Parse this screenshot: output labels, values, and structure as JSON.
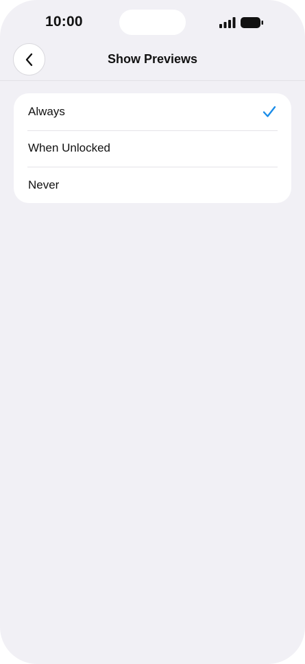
{
  "status_bar": {
    "time": "10:00"
  },
  "nav": {
    "back_icon": "chevron-left-icon",
    "title": "Show Previews"
  },
  "options": [
    {
      "label": "Always",
      "selected": true
    },
    {
      "label": "When Unlocked",
      "selected": false
    },
    {
      "label": "Never",
      "selected": false
    }
  ],
  "colors": {
    "background": "#f1f0f5",
    "card": "#ffffff",
    "accent": "#1a8ce8"
  }
}
